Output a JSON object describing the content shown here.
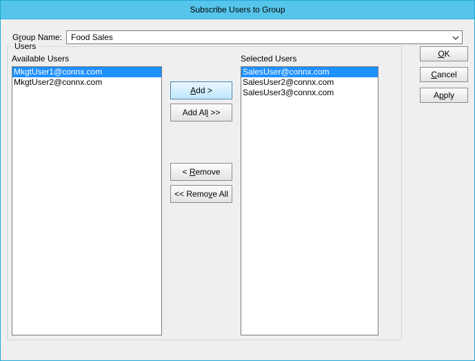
{
  "window": {
    "title": "Subscribe Users to Group"
  },
  "groupRow": {
    "label_pre": "G",
    "label_u": "r",
    "label_post": "oup Name:",
    "value": "Food Sales"
  },
  "fieldset": {
    "legend": "Users",
    "available_label": "Available Users",
    "selected_label": "Selected Users"
  },
  "available": [
    {
      "text": "MkgtUser1@connx.com",
      "selected": true
    },
    {
      "text": "MkgtUser2@connx.com",
      "selected": false
    }
  ],
  "selected": [
    {
      "text": "SalesUser@connx.com",
      "selected": true
    },
    {
      "text": "SalesUser2@connx.com",
      "selected": false
    },
    {
      "text": "SalesUser3@connx.com",
      "selected": false
    }
  ],
  "midButtons": {
    "add_u": "A",
    "add_post": "dd >",
    "addall_pre": "Add Al",
    "addall_u": "l",
    "addall_post": " >>",
    "remove_pre": "< ",
    "remove_u": "R",
    "remove_post": "emove",
    "removeall_pre": "<< Remo",
    "removeall_u": "v",
    "removeall_post": "e All"
  },
  "actions": {
    "ok_u": "O",
    "ok_post": "K",
    "cancel_u": "C",
    "cancel_post": "ancel",
    "apply_pre": "A",
    "apply_u": "p",
    "apply_post": "ply"
  }
}
